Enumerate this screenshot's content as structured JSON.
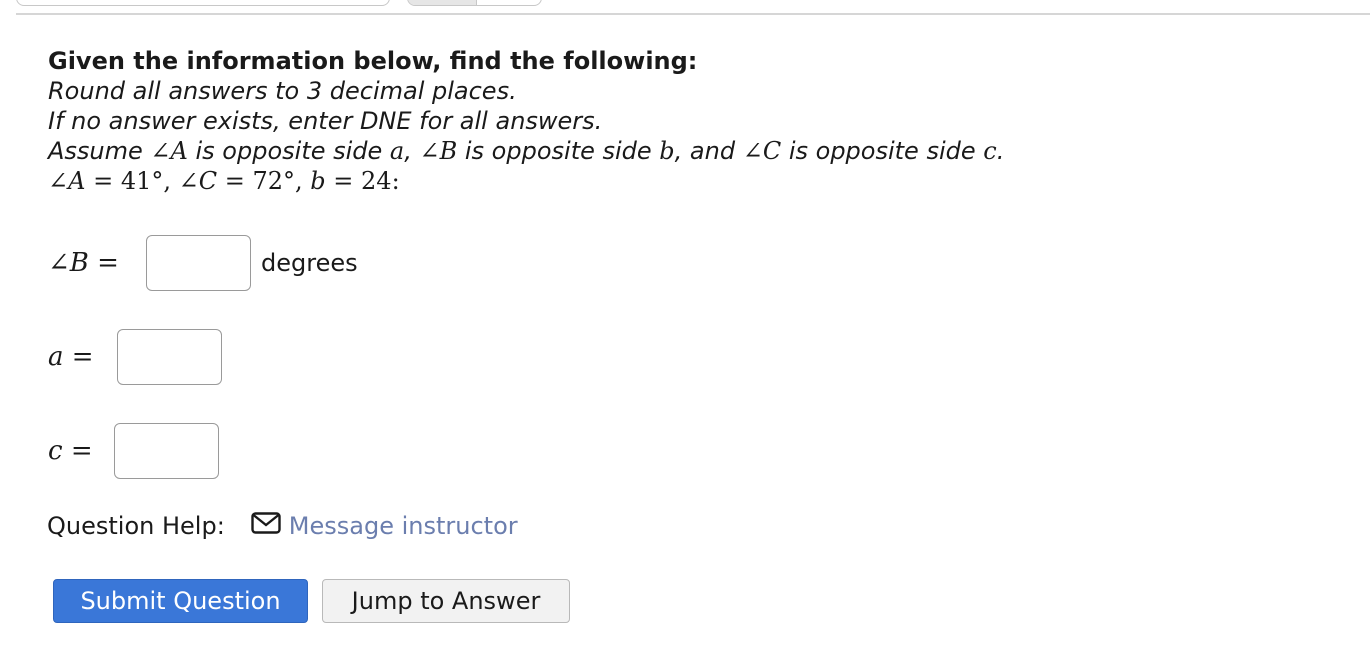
{
  "question": {
    "heading": "Given the information below, find the following:",
    "instruction_round": "Round all answers to 3 decimal places.",
    "instruction_dne": "If no answer exists, enter DNE for all answers.",
    "assume": {
      "prefix": "Assume ",
      "angle_a": "∠A",
      "opp1": " is opposite side ",
      "side_a": "a",
      "comma1": ", ",
      "angle_b": "∠B",
      "opp2": " is opposite side ",
      "side_b": "b",
      "and": ", and ",
      "angle_c": "∠C",
      "opp3": " is opposite side ",
      "side_c": "c",
      "period": "."
    },
    "given": {
      "angle_a_label": "∠A",
      "angle_a_value": " = 41°, ",
      "angle_c_label": "∠C",
      "angle_c_value": " = 72°, ",
      "side_b_label": "b",
      "side_b_value": " = 24:"
    }
  },
  "answers": [
    {
      "var": "∠B",
      "eq": " = ",
      "value": "",
      "unit": "degrees"
    },
    {
      "var": "a",
      "eq": " = ",
      "value": "",
      "unit": ""
    },
    {
      "var": "c",
      "eq": " = ",
      "value": "",
      "unit": ""
    }
  ],
  "help": {
    "label": "Question Help:",
    "icon": "mail-icon",
    "link_text": "Message instructor"
  },
  "buttons": {
    "submit": "Submit Question",
    "jump": "Jump to Answer"
  },
  "colors": {
    "primary": "#3a77d8",
    "link": "#6b7eae"
  }
}
